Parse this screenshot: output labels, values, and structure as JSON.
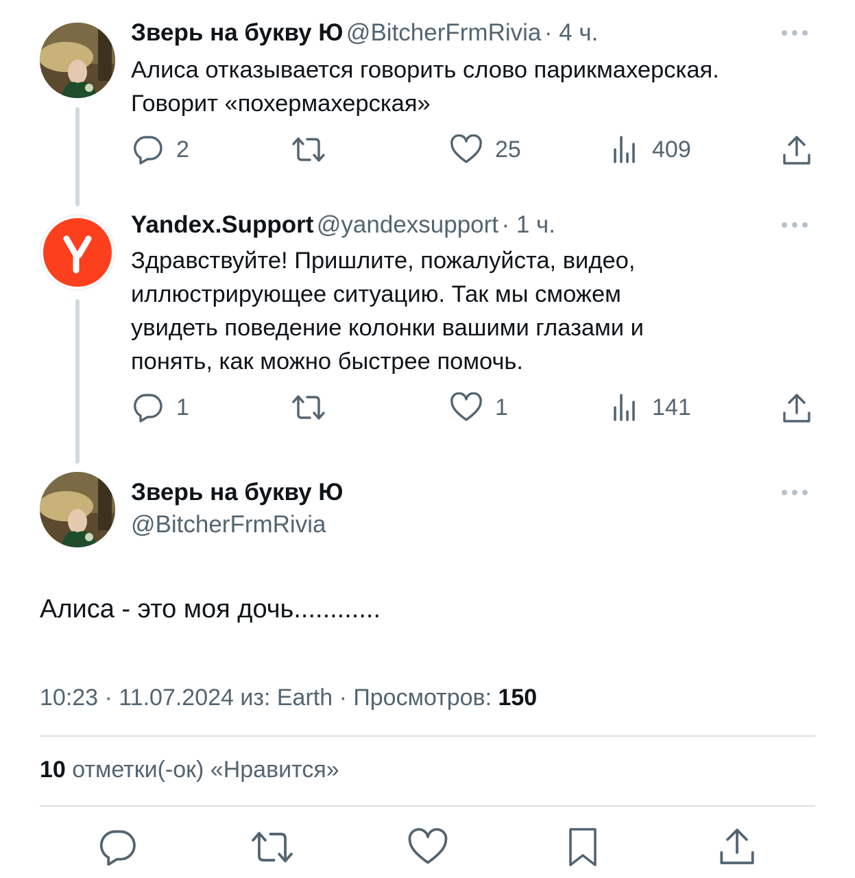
{
  "tweets": [
    {
      "author_name": "Зверь на букву Ю",
      "handle": "@BitcherFrmRivia",
      "time": "· 4 ч.",
      "text_lines": [
        "Алиса отказывается говорить слово парикмахерская.",
        "Говорит «похермахерская»"
      ],
      "replies": "2",
      "retweets": "",
      "likes": "25",
      "views": "409"
    },
    {
      "author_name": "Yandex.Support",
      "handle": "@yandexsupport",
      "time": "· 1 ч.",
      "text_lines": [
        "Здравствуйте! Пришлите, пожалуйста, видео,",
        "иллюстрирующее ситуацию. Так мы сможем",
        "увидеть поведение колонки вашими глазами и",
        "понять, как можно быстрее помочь."
      ],
      "replies": "1",
      "retweets": "",
      "likes": "1",
      "views": "141",
      "avatar_color": "#fc3f1d"
    }
  ],
  "main_tweet": {
    "author_name": "Зверь на букву Ю",
    "handle": "@BitcherFrmRivia",
    "text": "Алиса - это моя дочь............",
    "meta_prefix": "10:23 · 11.07.2024 из: Earth · Просмотров: ",
    "views": "150",
    "likes_count": "10",
    "likes_label": " отметки(-ок) «Нравится»"
  },
  "icons": [
    "more-dots-icon",
    "reply-icon",
    "retweet-icon",
    "like-icon",
    "views-icon",
    "share-icon",
    "bookmark-icon"
  ],
  "colors": {
    "text": "#0f1419",
    "secondary": "#536471",
    "yandex": "#fc3f1d",
    "divider": "#d9dee2"
  }
}
